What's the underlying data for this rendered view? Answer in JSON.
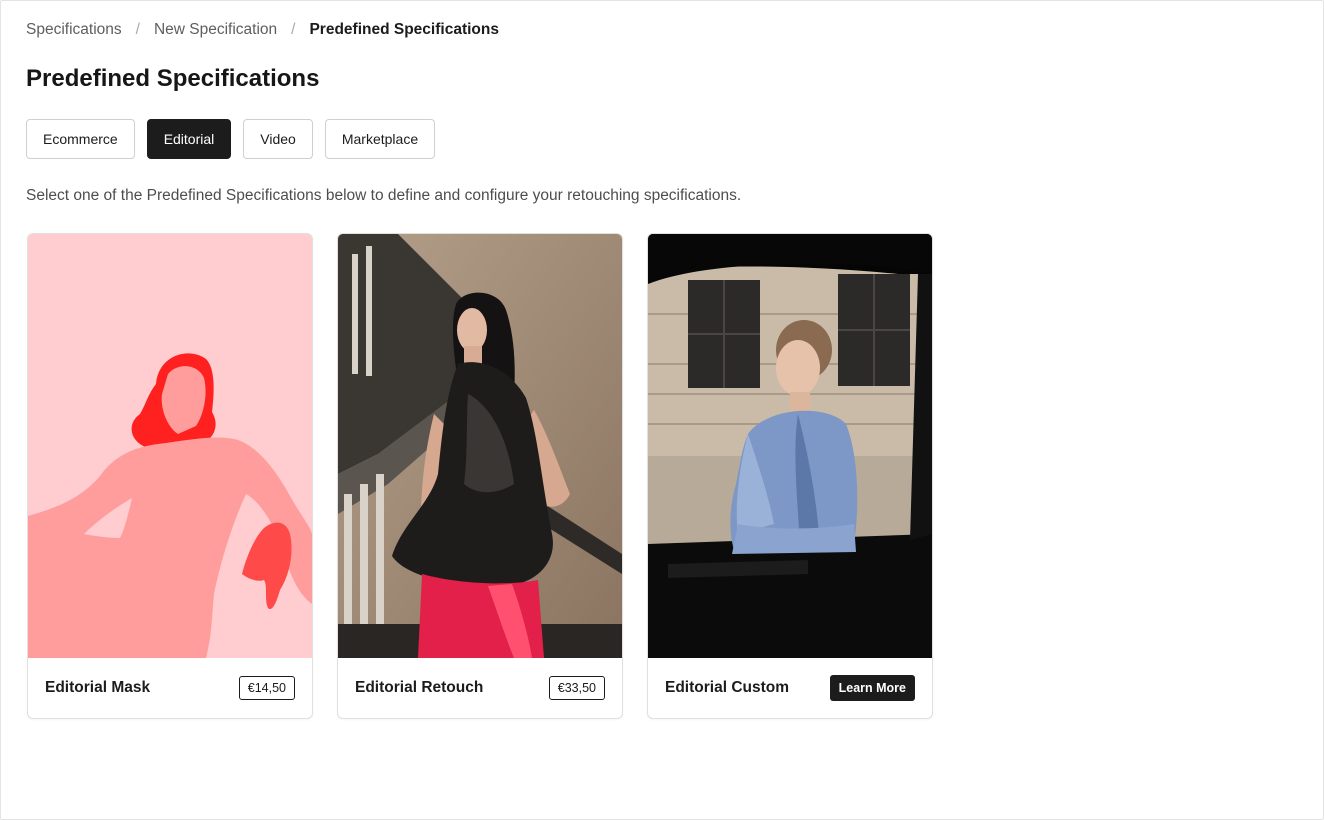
{
  "breadcrumb": {
    "items": [
      "Specifications",
      "New Specification",
      "Predefined Specifications"
    ],
    "separator": "/"
  },
  "page": {
    "title": "Predefined Specifications",
    "description": "Select one of the Predefined Specifications below to define and configure your retouching specifications."
  },
  "tabs": [
    {
      "label": "Ecommerce",
      "active": false
    },
    {
      "label": "Editorial",
      "active": true
    },
    {
      "label": "Video",
      "active": false
    },
    {
      "label": "Marketplace",
      "active": false
    }
  ],
  "cards": [
    {
      "title": "Editorial Mask",
      "price": "€14,50"
    },
    {
      "title": "Editorial Retouch",
      "price": "€33,50"
    },
    {
      "title": "Editorial Custom",
      "action_label": "Learn More"
    }
  ],
  "colors": {
    "accent_dark": "#1c1c1c",
    "mask_background": "#ffcccf",
    "mask_body": "#ff9c9c",
    "mask_hair": "#ff2020"
  }
}
